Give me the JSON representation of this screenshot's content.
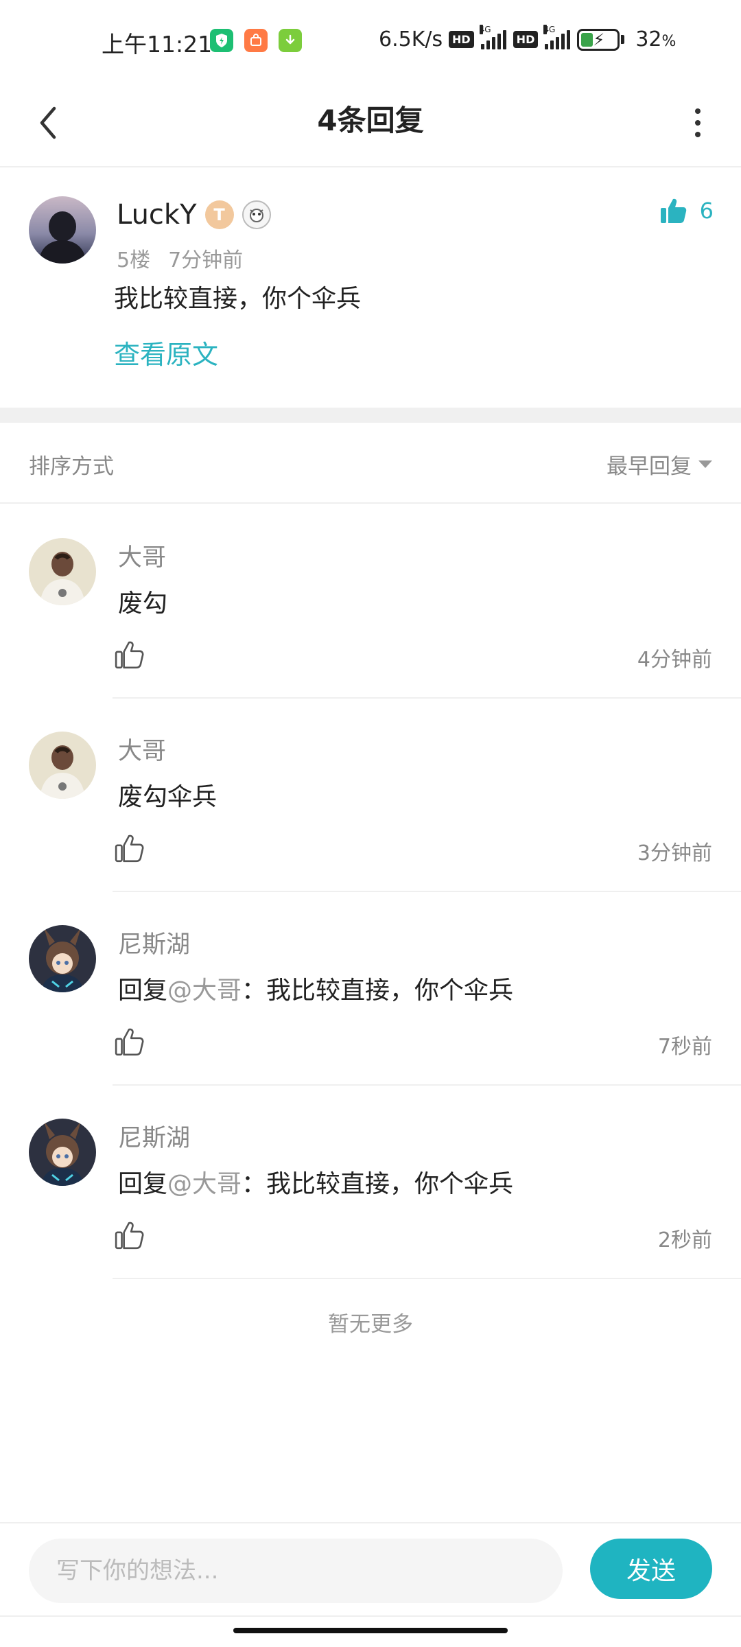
{
  "status_bar": {
    "time": "上午11:21",
    "network_speed": "6.5K/s",
    "hd_label": "HD",
    "net_type": "4G",
    "battery_value": "32",
    "battery_unit": "%",
    "app_icons": [
      "shield-app-icon",
      "mi-store-app-icon",
      "download-app-icon"
    ],
    "colors": {
      "shield": "#1dbf73",
      "mi": "#ff7a45",
      "download": "#7ccd3c"
    }
  },
  "header": {
    "title": "4条回复"
  },
  "original_comment": {
    "author": "LuckY",
    "level_badge": "T",
    "floor": "5楼",
    "time": "7分钟前",
    "content": "我比较直接，你个伞兵",
    "view_original_label": "查看原文",
    "like_count": "6"
  },
  "sort_bar": {
    "label": "排序方式",
    "selected": "最早回复"
  },
  "replies": [
    {
      "author": "大哥",
      "reply_prefix": "",
      "mention": "",
      "text": "废勾",
      "time": "4分钟前"
    },
    {
      "author": "大哥",
      "reply_prefix": "",
      "mention": "",
      "text": "废勾伞兵",
      "time": "3分钟前"
    },
    {
      "author": "尼斯湖",
      "reply_prefix": "回复",
      "mention": "@大哥",
      "text": "：我比较直接，你个伞兵",
      "time": "7秒前"
    },
    {
      "author": "尼斯湖",
      "reply_prefix": "回复",
      "mention": "@大哥",
      "text": "：我比较直接，你个伞兵",
      "time": "2秒前"
    }
  ],
  "footer_text": "暂无更多",
  "input_bar": {
    "placeholder": "写下你的想法...",
    "send_label": "发送"
  },
  "colors": {
    "accent": "#2bb3c0",
    "send_button": "#1fb4c1"
  }
}
